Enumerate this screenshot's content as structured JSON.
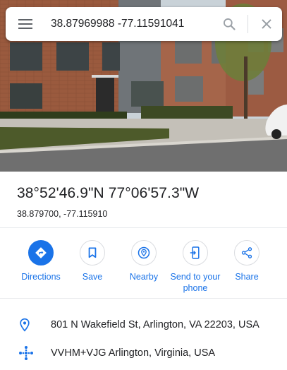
{
  "search": {
    "value": "38.87969988 -77.11591041"
  },
  "place": {
    "coords_dms": "38°52'46.9\"N 77°06'57.3\"W",
    "coords_decimal": "38.879700, -77.115910"
  },
  "actions": [
    {
      "label": "Directions",
      "icon": "directions-icon"
    },
    {
      "label": "Save",
      "icon": "bookmark-icon"
    },
    {
      "label": "Nearby",
      "icon": "nearby-icon"
    },
    {
      "label": "Send to your phone",
      "icon": "send-to-phone-icon"
    },
    {
      "label": "Share",
      "icon": "share-icon"
    }
  ],
  "info": {
    "address": "801 N Wakefield St, Arlington, VA 22203, USA",
    "plus_code": "VVHM+VJG Arlington, Virginia, USA"
  },
  "colors": {
    "accent": "#1a73e8",
    "divider": "#e8eaed",
    "icon_grey": "#5f6368"
  }
}
